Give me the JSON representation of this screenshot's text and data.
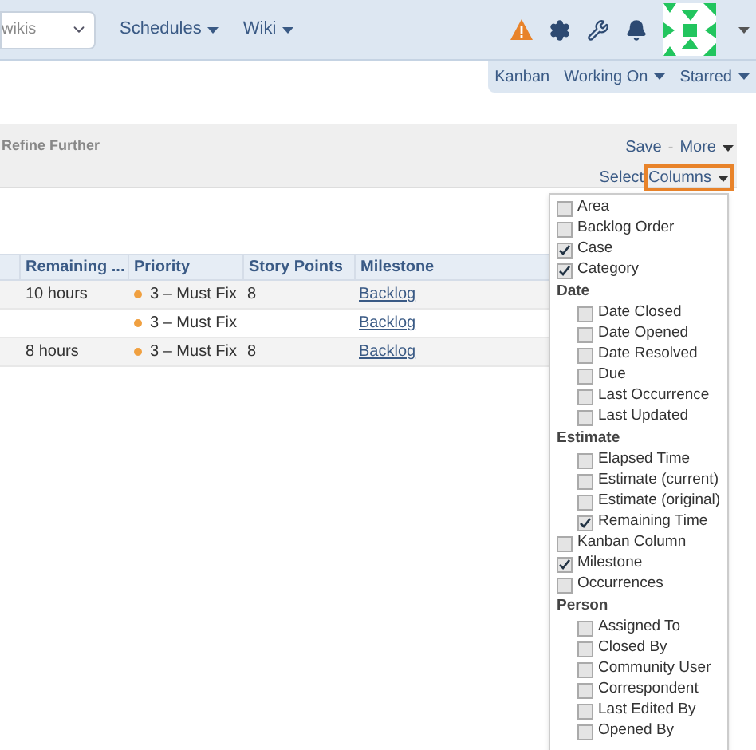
{
  "top_nav": {
    "search": {
      "value": "wikis"
    },
    "menus": [
      {
        "label": "Schedules"
      },
      {
        "label": "Wiki"
      }
    ]
  },
  "sub_nav": [
    {
      "label": "Kanban",
      "dropdown": false
    },
    {
      "label": "Working On",
      "dropdown": true
    },
    {
      "label": "Starred",
      "dropdown": true
    }
  ],
  "filter_bar": {
    "refine": "Refine Further",
    "save": "Save",
    "separator": "-",
    "more": "More",
    "select": "Select",
    "columns": "Columns"
  },
  "table": {
    "columns": [
      "Remaining ...",
      "Priority",
      "Story Points",
      "Milestone"
    ],
    "rows": [
      {
        "remaining": "10 hours",
        "priority": "3 – Must Fix",
        "story_points": "8",
        "milestone": "Backlog"
      },
      {
        "remaining": "",
        "priority": "3 – Must Fix",
        "story_points": "",
        "milestone": "Backlog"
      },
      {
        "remaining": "8 hours",
        "priority": "3 – Must Fix",
        "story_points": "8",
        "milestone": "Backlog"
      }
    ]
  },
  "columns_menu": [
    {
      "kind": "option",
      "label": "Area",
      "checked": false
    },
    {
      "kind": "option",
      "label": "Backlog Order",
      "checked": false
    },
    {
      "kind": "option",
      "label": "Case",
      "checked": true
    },
    {
      "kind": "option",
      "label": "Category",
      "checked": true
    },
    {
      "kind": "group",
      "label": "Date",
      "children": [
        {
          "label": "Date Closed",
          "checked": false
        },
        {
          "label": "Date Opened",
          "checked": false
        },
        {
          "label": "Date Resolved",
          "checked": false
        },
        {
          "label": "Due",
          "checked": false
        },
        {
          "label": "Last Occurrence",
          "checked": false
        },
        {
          "label": "Last Updated",
          "checked": false
        }
      ]
    },
    {
      "kind": "group",
      "label": "Estimate",
      "children": [
        {
          "label": "Elapsed Time",
          "checked": false
        },
        {
          "label": "Estimate (current)",
          "checked": false
        },
        {
          "label": "Estimate (original)",
          "checked": false
        },
        {
          "label": "Remaining Time",
          "checked": true
        }
      ]
    },
    {
      "kind": "option",
      "label": "Kanban Column",
      "checked": false
    },
    {
      "kind": "option",
      "label": "Milestone",
      "checked": true
    },
    {
      "kind": "option",
      "label": "Occurrences",
      "checked": false
    },
    {
      "kind": "group",
      "label": "Person",
      "children": [
        {
          "label": "Assigned To",
          "checked": false
        },
        {
          "label": "Closed By",
          "checked": false
        },
        {
          "label": "Community User",
          "checked": false
        },
        {
          "label": "Correspondent",
          "checked": false
        },
        {
          "label": "Last Edited By",
          "checked": false
        },
        {
          "label": "Opened By",
          "checked": false
        }
      ]
    }
  ]
}
